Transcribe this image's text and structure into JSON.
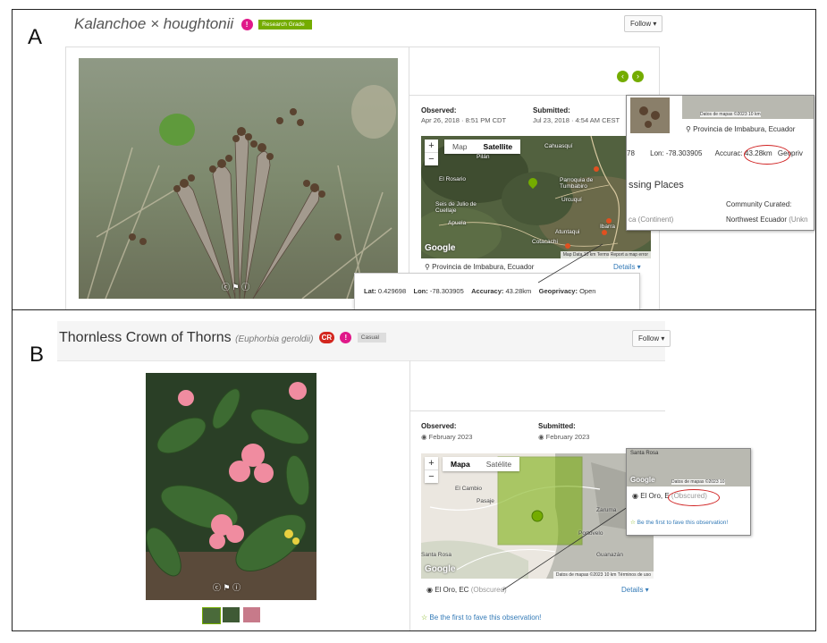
{
  "panel_a": {
    "letter": "A",
    "title": "Kalanchoe × houghtonii",
    "research_grade": "Research Grade",
    "follow": "Follow ▾",
    "observed_label": "Observed:",
    "observed_value": "Apr 26, 2018 · 8:51 PM CDT",
    "submitted_label": "Submitted:",
    "submitted_value": "Jul 23, 2018 · 4:54 AM CEST",
    "map_tab": "Map",
    "satellite_tab": "Satellite",
    "map_places": [
      "Pilán",
      "Cahuasquí",
      "El Rosario",
      "Parroquia de Tumbabiro",
      "Urcuquí",
      "Seis de Julio de Cuellaje",
      "Apuela",
      "Atuntaqui",
      "Ibarra",
      "Cotacachi"
    ],
    "google": "Google",
    "attribution": "Map Data  10 km  Terms  Report a map error",
    "place": "Provincia de Imbabura, Ecuador",
    "details": "Details ▾",
    "lat_label": "Lat:",
    "lat_value": "0.429698",
    "lon_label": "Lon:",
    "lon_value": "-78.303905",
    "accuracy_label": "Accuracy:",
    "accuracy_value": "43.28km",
    "geoprivacy_label": "Geoprivacy:",
    "geoprivacy_value": "Open",
    "inset": {
      "attribution": "Datos de mapas ©2023  10 km",
      "place": "Provincia de Imbabura, Ecuador",
      "lon_row_prefix": "78",
      "lon": "Lon: -78.303905",
      "accuracy": "Accurac: 43.28km",
      "geoprivacy": "Geopriv",
      "places_heading": "ssing Places",
      "community": "Community Curated:",
      "continent": "ca (Continent)",
      "region": "Northwest Ecuador",
      "unknown": "(Unkn"
    }
  },
  "panel_b": {
    "letter": "B",
    "title": "Thornless Crown of Thorns",
    "scientific": "(Euphorbia geroldii)",
    "cr": "CR",
    "casual": "Casual",
    "follow": "Follow ▾",
    "observed_label": "Observed:",
    "observed_value": "February 2023",
    "submitted_label": "Submitted:",
    "submitted_value": "February 2023",
    "map_tab": "Mapa",
    "satellite_tab": "Satélite",
    "map_places": [
      "El Cambio",
      "Pasaje",
      "Santa Rosa",
      "Portovelo",
      "Guanazán",
      "Zaruma"
    ],
    "google": "Google",
    "attribution": "Datos de mapas ©2023  10 km  Términos de uso",
    "place": "El Oro, EC",
    "obscured": "(Obscured)",
    "details": "Details ▾",
    "fave": "Be the first to fave this observation!",
    "inset": {
      "top_label": "Santa Rosa",
      "attribution": "Datos de mapas ©2023  10",
      "place": "El Oro, E",
      "obscured": "(Obscured)",
      "fave": "Be the first to fave this observation!"
    }
  },
  "colors": {
    "research_green": "#74ac00",
    "id_pink": "#e0198a",
    "cr_red": "#d3271f",
    "casual_grey": "#dddddd",
    "link_blue": "#337ab7",
    "annotation_red": "#d02020"
  }
}
